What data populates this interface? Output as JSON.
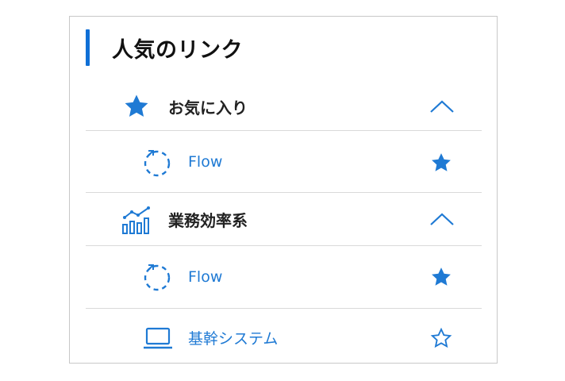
{
  "panel": {
    "title": "人気のリンク",
    "accent_color": "#0f6fd6"
  },
  "groups": [
    {
      "label": "お気に入り",
      "icon": "star-icon",
      "expanded": true,
      "items": [
        {
          "label": "Flow",
          "icon": "flow-icon",
          "favorite": true
        }
      ]
    },
    {
      "label": "業務効率系",
      "icon": "analytics-chart-icon",
      "expanded": true,
      "items": [
        {
          "label": "Flow",
          "icon": "flow-icon",
          "favorite": true
        },
        {
          "label": "基幹システム",
          "icon": "laptop-icon",
          "favorite": false
        }
      ]
    }
  ],
  "colors": {
    "primary": "#1f7ad4",
    "divider": "#d9d9d9",
    "text": "#222222"
  }
}
